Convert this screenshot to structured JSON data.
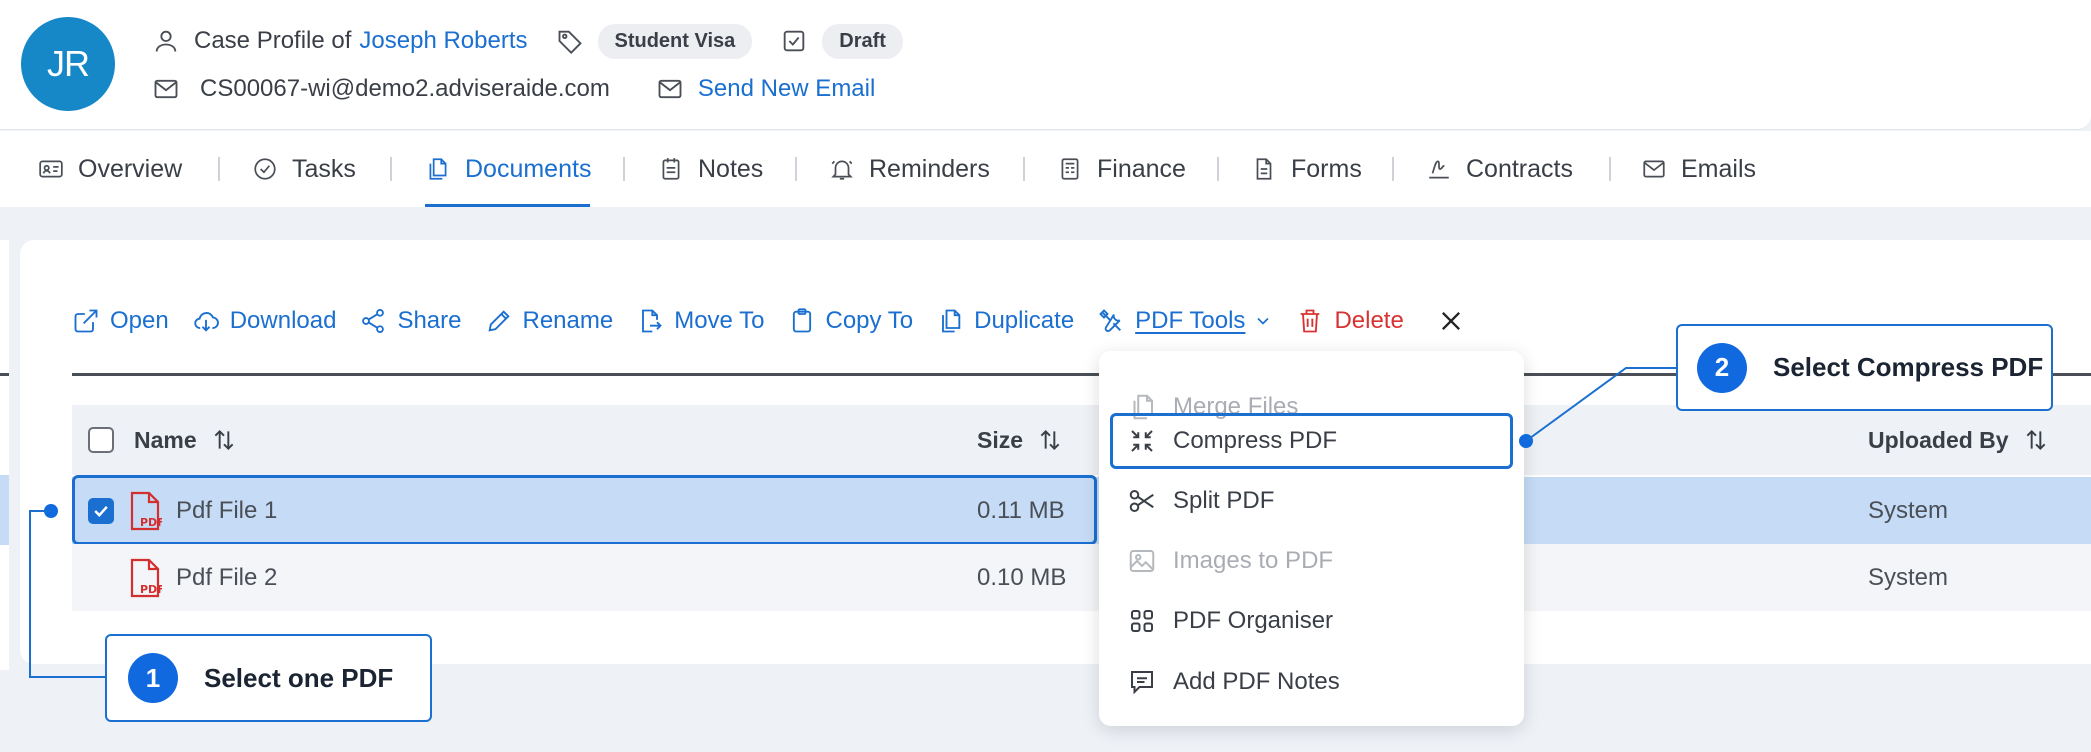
{
  "header": {
    "avatar_initials": "JR",
    "case_profile_prefix": "Case Profile of",
    "client_name": "Joseph Roberts",
    "visa_tag": "Student Visa",
    "status_tag": "Draft",
    "email": "CS00067-wi@demo2.adviseraide.com",
    "send_email_label": "Send New Email"
  },
  "tabs": [
    {
      "label": "Overview",
      "icon": "id-card-icon"
    },
    {
      "label": "Tasks",
      "icon": "check-circle-icon"
    },
    {
      "label": "Documents",
      "icon": "documents-icon",
      "active": true
    },
    {
      "label": "Notes",
      "icon": "notepad-icon"
    },
    {
      "label": "Reminders",
      "icon": "bell-icon"
    },
    {
      "label": "Finance",
      "icon": "ledger-icon"
    },
    {
      "label": "Forms",
      "icon": "form-icon"
    },
    {
      "label": "Contracts",
      "icon": "signature-icon"
    },
    {
      "label": "Emails",
      "icon": "mail-icon"
    }
  ],
  "toolbar": {
    "open": "Open",
    "download": "Download",
    "share": "Share",
    "rename": "Rename",
    "move_to": "Move To",
    "copy_to": "Copy To",
    "duplicate": "Duplicate",
    "pdf_tools": "PDF Tools",
    "delete": "Delete"
  },
  "table": {
    "columns": {
      "name": "Name",
      "size": "Size",
      "uploaded_by": "Uploaded By"
    },
    "rows": [
      {
        "name": "Pdf File 1",
        "size": "0.11 MB",
        "uploaded_by": "System",
        "checked": true
      },
      {
        "name": "Pdf File 2",
        "size": "0.10 MB",
        "uploaded_by": "System",
        "checked": false
      }
    ]
  },
  "pdf_menu": [
    {
      "label": "Merge Files",
      "enabled": false
    },
    {
      "label": "Compress PDF",
      "enabled": true,
      "highlighted": true
    },
    {
      "label": "Split PDF",
      "enabled": true
    },
    {
      "label": "Images to PDF",
      "enabled": false
    },
    {
      "label": "PDF Organiser",
      "enabled": true
    },
    {
      "label": "Add PDF Notes",
      "enabled": true
    }
  ],
  "callouts": [
    {
      "number": "1",
      "text": "Select one PDF"
    },
    {
      "number": "2",
      "text": "Select Compress PDF"
    }
  ],
  "colors": {
    "accent": "#1a6fd0",
    "avatar": "#1688c8",
    "delete": "#d83333",
    "selected_row": "#c6dcf6",
    "pdf_red": "#d32f2f"
  }
}
